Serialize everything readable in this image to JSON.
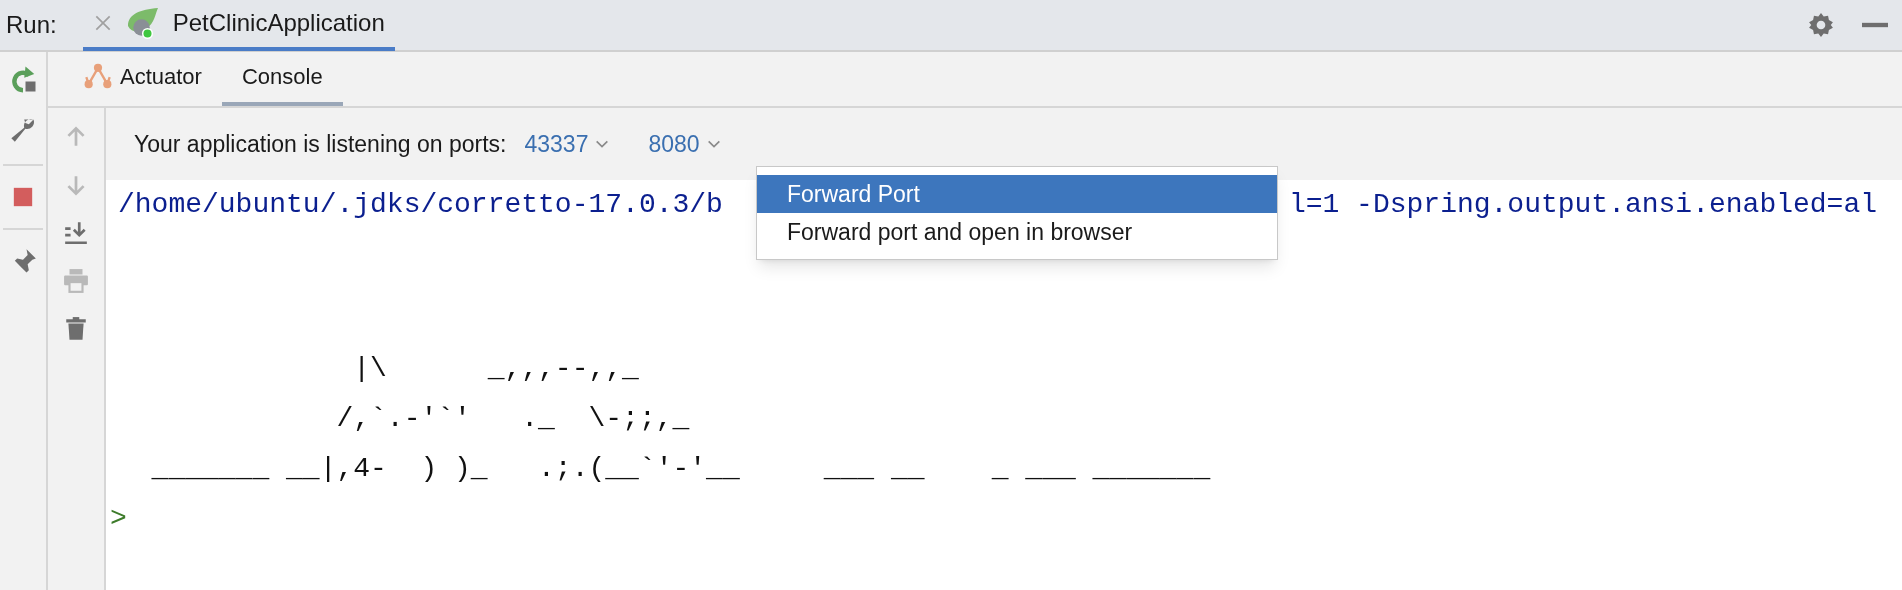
{
  "run_bar": {
    "label": "Run:",
    "tabs": [
      {
        "title": "PetClinicApplication",
        "selected": true
      }
    ]
  },
  "tool_tabs": [
    {
      "label": "Actuator",
      "kind": "actuator",
      "selected": false
    },
    {
      "label": "Console",
      "kind": "console",
      "selected": true
    }
  ],
  "console_toolbar": [
    {
      "kind": "up",
      "disabled": true
    },
    {
      "kind": "down",
      "disabled": true
    },
    {
      "kind": "scroll-end",
      "disabled": false
    },
    {
      "kind": "print",
      "disabled": true
    },
    {
      "kind": "trash",
      "disabled": false
    }
  ],
  "ports_bar": {
    "label": "Your application is listening on ports:",
    "ports": [
      "43337",
      "8080"
    ]
  },
  "port_menu": {
    "items": [
      {
        "label": "Forward Port",
        "selected": true
      },
      {
        "label": "Forward port and open in browser",
        "selected": false
      }
    ]
  },
  "console": {
    "command": [
      "/home/ubuntu/.jdks/corretto-17.0.3/b",
      "l=1 -Dspring.output.ansi.enabled=al"
    ],
    "banner": [
      "              |\\      _,,,--,,_",
      "             /,`.-'`'   ._  \\-;;,_",
      "  _______ __|,4-  ) )_   .;.(__`'-'__     ___ __    _ ___ _______"
    ],
    "prompt": ">"
  }
}
